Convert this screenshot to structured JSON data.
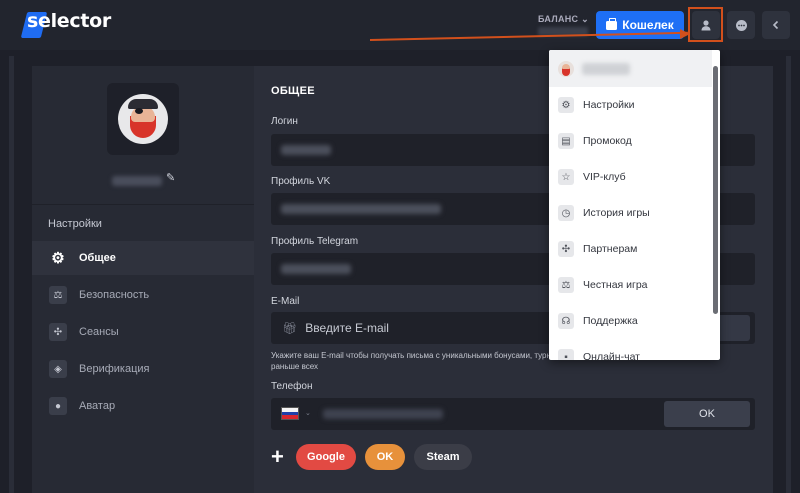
{
  "header": {
    "logo_text": "selector",
    "balance_label": "БАЛАНС ⌄",
    "wallet_label": "Кошелек",
    "icons": {
      "user": "user-icon",
      "chat": "chat-icon",
      "back": "chevron-left-icon"
    }
  },
  "sidebar": {
    "title": "Настройки",
    "items": [
      {
        "label": "Общее",
        "icon": "gear-icon",
        "active": true
      },
      {
        "label": "Безопасность",
        "icon": "scales-icon",
        "active": false
      },
      {
        "label": "Сеансы",
        "icon": "sessions-icon",
        "active": false
      },
      {
        "label": "Верификация",
        "icon": "shield-icon",
        "active": false
      },
      {
        "label": "Аватар",
        "icon": "avatar-icon",
        "active": false
      }
    ]
  },
  "main": {
    "section_title": "ОБЩЕЕ",
    "login_label": "Логин",
    "vk_label": "Профиль VK",
    "telegram_label": "Профиль Telegram",
    "email_label": "E-Mail",
    "email_placeholder": "Введите E-mail",
    "email_hint": "Укажите ваш E-mail чтобы получать письма с уникальными бонусами, турнирах раньше всех",
    "phone_label": "Телефон",
    "phone_ok": "OK",
    "plus": "+",
    "social": {
      "google": "Google",
      "ok": "OK",
      "steam": "Steam"
    }
  },
  "dropdown": {
    "items": [
      {
        "label": "Настройки",
        "icon": "gear-icon",
        "glyph": "⚙"
      },
      {
        "label": "Промокод",
        "icon": "promo-icon",
        "glyph": "▤"
      },
      {
        "label": "VIP-клуб",
        "icon": "star-icon",
        "glyph": "☆"
      },
      {
        "label": "История игры",
        "icon": "history-icon",
        "glyph": "◷"
      },
      {
        "label": "Партнерам",
        "icon": "partners-icon",
        "glyph": "✣"
      },
      {
        "label": "Честная игра",
        "icon": "scales-icon",
        "glyph": "⚖"
      },
      {
        "label": "Поддержка",
        "icon": "headset-icon",
        "glyph": "☊"
      },
      {
        "label": "Онлайн-чат",
        "icon": "chat-icon",
        "glyph": "▪"
      }
    ]
  },
  "colors": {
    "accent": "#1e6ff5",
    "annotation": "#d2501c",
    "google": "#e24a43",
    "ok": "#e7913b"
  }
}
